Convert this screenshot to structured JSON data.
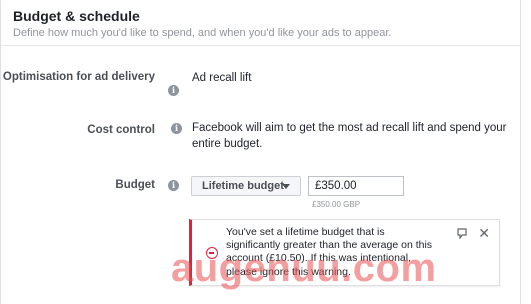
{
  "section": {
    "title": "Budget & schedule",
    "subtitle": "Define how much you'd like to spend, and when you'd like your ads to appear."
  },
  "optimisation": {
    "label": "Optimisation for ad delivery",
    "value": "Ad recall lift"
  },
  "cost_control": {
    "label": "Cost control",
    "line1": "Facebook will aim to get the most ad recall lift and spend your",
    "line2": "entire budget."
  },
  "budget": {
    "label": "Budget",
    "type_selected": "Lifetime budget",
    "amount": "£350.00",
    "amount_sub": "£350.00 GBP"
  },
  "warning": {
    "line1": "You've set a lifetime budget that is",
    "line2": "significantly greater than the average on this",
    "line3": "account (£10.50). If this was intentional,",
    "line4": "please ignore this warning.",
    "close_glyph": "✕"
  },
  "info_glyph": "i",
  "watermark": "augenuu.com",
  "colors": {
    "warning_accent": "#e41e3f",
    "label_text": "#4b4f56",
    "muted_text": "#90949c"
  },
  "icons": [
    "info-icon",
    "chevron-down-icon",
    "warning-icon",
    "feedback-flag-icon",
    "close-icon"
  ]
}
